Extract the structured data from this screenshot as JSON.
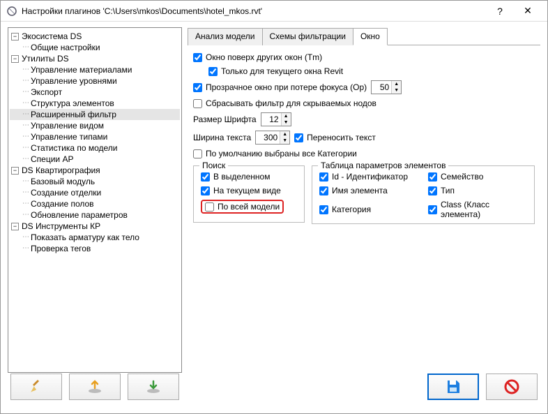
{
  "window": {
    "title": "Настройки плагинов 'C:\\Users\\mkos\\Documents\\hotel_mkos.rvt'"
  },
  "tree": {
    "nodes": [
      {
        "label": "Экосистема DS",
        "expanded": true,
        "children": [
          {
            "label": "Общие настройки"
          }
        ]
      },
      {
        "label": "Утилиты DS",
        "expanded": true,
        "children": [
          {
            "label": "Управление материалами"
          },
          {
            "label": "Управление уровнями"
          },
          {
            "label": "Экспорт"
          },
          {
            "label": "Структура элементов"
          },
          {
            "label": "Расширенный фильтр",
            "selected": true
          },
          {
            "label": "Управление видом"
          },
          {
            "label": "Управление типами"
          },
          {
            "label": "Статистика по модели"
          },
          {
            "label": "Специи АР"
          }
        ]
      },
      {
        "label": "DS Квартирография",
        "expanded": true,
        "children": [
          {
            "label": "Базовый модуль"
          },
          {
            "label": "Создание отделки"
          },
          {
            "label": "Создание полов"
          },
          {
            "label": "Обновление параметров"
          }
        ]
      },
      {
        "label": "DS Инструменты КР",
        "expanded": true,
        "children": [
          {
            "label": "Показать арматуру как тело"
          },
          {
            "label": "Проверка тегов"
          }
        ]
      }
    ]
  },
  "tabs": [
    {
      "label": "Анализ модели"
    },
    {
      "label": "Схемы фильтрации"
    },
    {
      "label": "Окно",
      "active": true
    }
  ],
  "settings": {
    "topmost": {
      "label": "Окно поверх других окон (Tm)",
      "checked": true
    },
    "topmost_current": {
      "label": "Только для текущего окна Revit",
      "checked": true
    },
    "transparent": {
      "label": "Прозрачное окно при потере фокуса (Op)",
      "checked": true,
      "value": "50"
    },
    "reset_filter": {
      "label": "Сбрасывать фильтр для скрываемых нодов",
      "checked": false
    },
    "font_size": {
      "label": "Размер Шрифта",
      "value": "12"
    },
    "text_width": {
      "label": "Ширина текста",
      "value": "300"
    },
    "wrap_text": {
      "label": "Переносить текст",
      "checked": true
    },
    "default_all_categories": {
      "label": "По умолчанию выбраны все Категории",
      "checked": false
    }
  },
  "search": {
    "legend": "Поиск",
    "in_selection": {
      "label": "В выделенном",
      "checked": true
    },
    "in_current_view": {
      "label": "На текущем виде",
      "checked": true
    },
    "in_whole_model": {
      "label": "По всей модели",
      "checked": false
    }
  },
  "param_table": {
    "legend": "Таблица параметров элементов",
    "id": {
      "label": "Id - Идентификатор",
      "checked": true
    },
    "name": {
      "label": "Имя элемента",
      "checked": true
    },
    "category": {
      "label": "Категория",
      "checked": true
    },
    "family": {
      "label": "Семейство",
      "checked": true
    },
    "type": {
      "label": "Тип",
      "checked": true
    },
    "class": {
      "label": "Class (Класс элемента)",
      "checked": true
    }
  }
}
